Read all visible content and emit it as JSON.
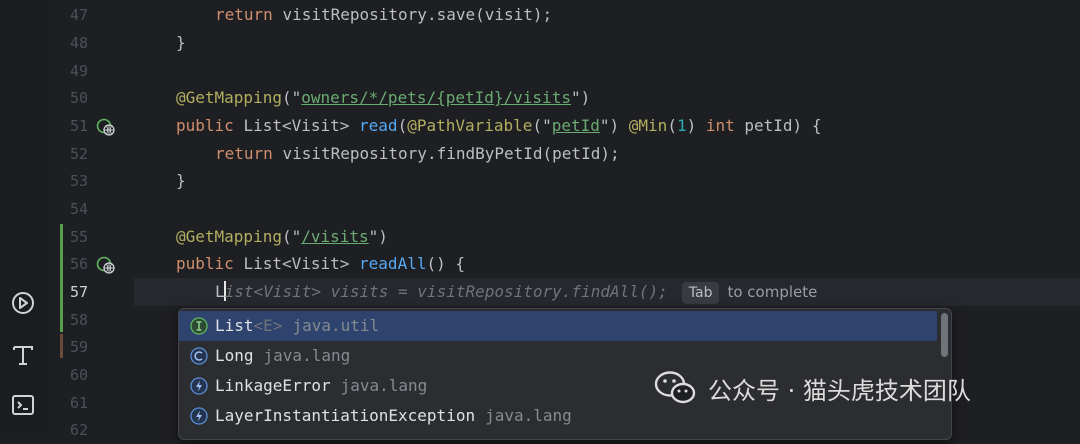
{
  "gutter": {
    "line_numbers": [
      "47",
      "48",
      "49",
      "50",
      "51",
      "52",
      "53",
      "54",
      "55",
      "56",
      "57",
      "58",
      "59",
      "60",
      "61",
      "62"
    ],
    "current_line": "57"
  },
  "code": {
    "l47": {
      "kw": "return ",
      "obj": "visitRepository",
      "rest": ".save(visit);"
    },
    "l48": "}",
    "l50": {
      "ann": "@GetMapping",
      "open": "(\"",
      "str": "owners/*/pets/{petId}/visits",
      "close": "\")"
    },
    "l51": {
      "kw1": "public ",
      "type": "List<Visit> ",
      "fn": "read",
      "p1": "(",
      "ann1": "@PathVariable",
      "p2": "(\"",
      "str": "petId",
      "p3": "\") ",
      "ann2": "@Min",
      "p4": "(",
      "num": "1",
      "p5": ") ",
      "kw2": "int ",
      "rest": "petId) {"
    },
    "l52": {
      "kw": "return ",
      "obj": "visitRepository",
      "rest": ".findByPetId(petId);"
    },
    "l53": "}",
    "l55": {
      "ann": "@GetMapping",
      "open": "(\"",
      "str": "/visits",
      "close": "\")"
    },
    "l56": {
      "kw1": "public ",
      "type": "List<Visit> ",
      "fn": "readAll",
      "rest": "() {"
    },
    "l57": {
      "typed": "L",
      "ghost": "ist<Visit> visits = visitRepository.findAll();",
      "tab_key": "Tab",
      "tab_text": "to complete"
    }
  },
  "completion": {
    "items": [
      {
        "icon": "interface-icon",
        "name": "List",
        "type": "<E>",
        "pkg": "java.util",
        "selected": true
      },
      {
        "icon": "class-icon",
        "name": "Long",
        "type": "",
        "pkg": "java.lang",
        "selected": false
      },
      {
        "icon": "exception-icon",
        "name": "LinkageError",
        "type": "",
        "pkg": "java.lang",
        "selected": false
      },
      {
        "icon": "exception-icon",
        "name": "LayerInstantiationException",
        "type": "",
        "pkg": "java.lang",
        "selected": false
      }
    ]
  },
  "watermark": {
    "text": "公众号 · 猫头虎技术团队"
  },
  "colors": {
    "keyword": "#cf8e6d",
    "annotation": "#b3ae60",
    "string": "#6aab73",
    "function": "#56a8f5",
    "number": "#2aacb8",
    "selected_item": "#2e436e",
    "change_marker": "#5a9e4b"
  }
}
